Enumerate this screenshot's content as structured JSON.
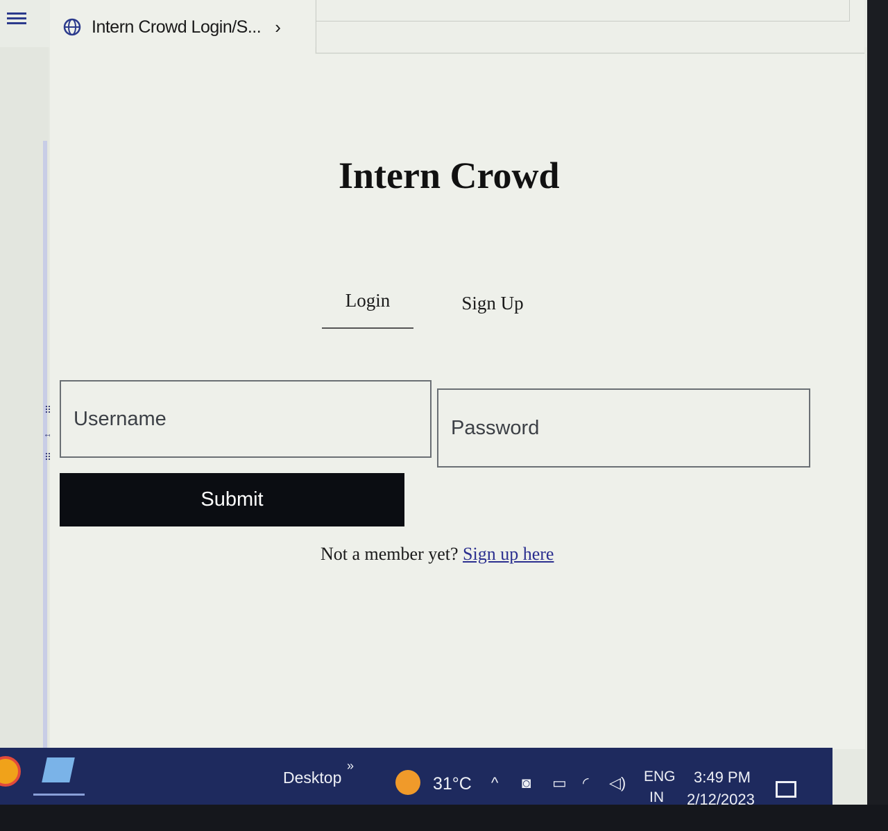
{
  "browser": {
    "tab_title": "Intern Crowd Login/S...",
    "tab_chevron": "›"
  },
  "app": {
    "title": "Intern Crowd",
    "tabs": {
      "login": "Login",
      "signup": "Sign Up"
    },
    "form": {
      "username_placeholder": "Username",
      "password_placeholder": "Password",
      "submit_label": "Submit"
    },
    "footer": {
      "prompt": "Not a member yet?",
      "link": "Sign up here"
    }
  },
  "taskbar": {
    "desktop_label": "Desktop",
    "overflow": "»",
    "temperature": "31°C",
    "language": "ENG",
    "region": "IN",
    "time": "3:49 PM",
    "date": "2/12/2023",
    "tray_icons": [
      "chevron-up-icon",
      "meet-now-icon",
      "battery-icon",
      "wifi-icon",
      "volume-icon"
    ]
  },
  "colors": {
    "page_background": "#eef0ea",
    "submit_background": "#0b0d12",
    "taskbar_background": "#1e2a5e",
    "link_color": "#2b2f8f"
  }
}
